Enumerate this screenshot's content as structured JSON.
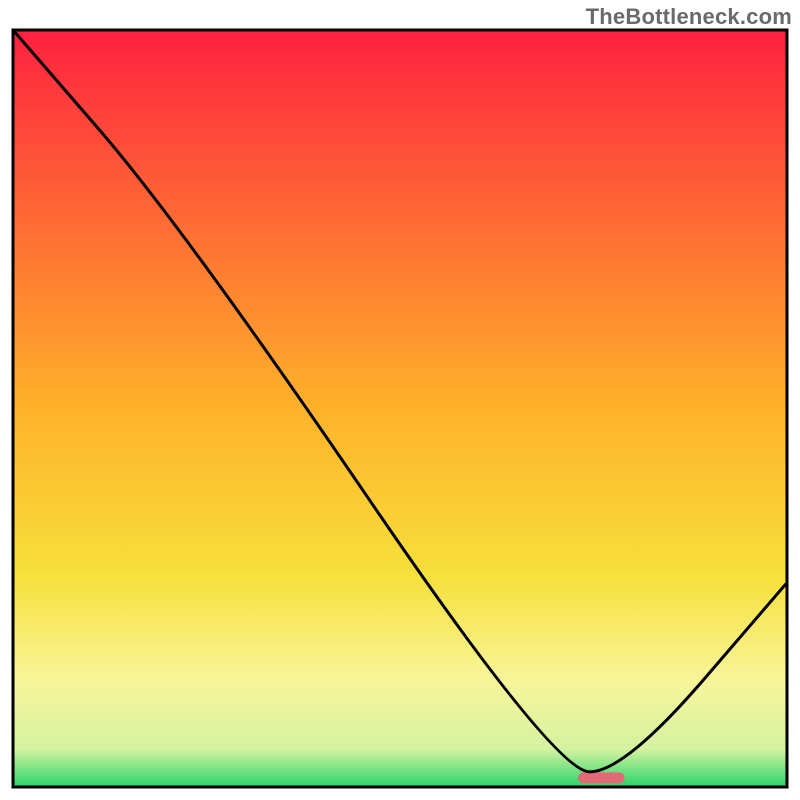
{
  "watermark": "TheBottleneck.com",
  "chart_data": {
    "type": "line",
    "title": "",
    "xlabel": "",
    "ylabel": "",
    "xlim": [
      0,
      100
    ],
    "ylim": [
      0,
      100
    ],
    "series": [
      {
        "name": "bottleneck-curve",
        "x": [
          0,
          22,
          70,
          79,
          100
        ],
        "y": [
          100,
          74,
          2,
          2,
          27
        ]
      }
    ],
    "marker": {
      "name": "optimal-zone",
      "x_start": 73,
      "x_end": 79,
      "y": 1.2,
      "color": "#e06b77"
    },
    "gradient_stops": [
      {
        "offset": 0.0,
        "color": "#ff1e40"
      },
      {
        "offset": 0.03,
        "color": "#ff2a3e"
      },
      {
        "offset": 0.5,
        "color": "#ffb22a"
      },
      {
        "offset": 0.72,
        "color": "#f6e03a"
      },
      {
        "offset": 0.86,
        "color": "#f8f59a"
      },
      {
        "offset": 0.95,
        "color": "#d4f2a0"
      },
      {
        "offset": 1.0,
        "color": "#29d46a"
      }
    ],
    "frame_color": "#000000",
    "curve_color": "#000000",
    "curve_width": 3
  }
}
